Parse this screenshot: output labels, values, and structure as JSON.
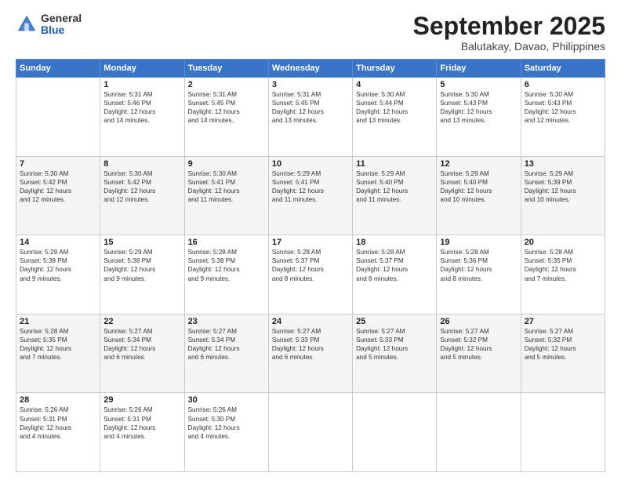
{
  "logo": {
    "general": "General",
    "blue": "Blue"
  },
  "title": "September 2025",
  "location": "Balutakay, Davao, Philippines",
  "days_of_week": [
    "Sunday",
    "Monday",
    "Tuesday",
    "Wednesday",
    "Thursday",
    "Friday",
    "Saturday"
  ],
  "weeks": [
    [
      {
        "day": "",
        "info": ""
      },
      {
        "day": "1",
        "info": "Sunrise: 5:31 AM\nSunset: 5:46 PM\nDaylight: 12 hours\nand 14 minutes."
      },
      {
        "day": "2",
        "info": "Sunrise: 5:31 AM\nSunset: 5:45 PM\nDaylight: 12 hours\nand 14 minutes."
      },
      {
        "day": "3",
        "info": "Sunrise: 5:31 AM\nSunset: 5:45 PM\nDaylight: 12 hours\nand 13 minutes."
      },
      {
        "day": "4",
        "info": "Sunrise: 5:30 AM\nSunset: 5:44 PM\nDaylight: 12 hours\nand 13 minutes."
      },
      {
        "day": "5",
        "info": "Sunrise: 5:30 AM\nSunset: 5:43 PM\nDaylight: 12 hours\nand 13 minutes."
      },
      {
        "day": "6",
        "info": "Sunrise: 5:30 AM\nSunset: 5:43 PM\nDaylight: 12 hours\nand 12 minutes."
      }
    ],
    [
      {
        "day": "7",
        "info": "Sunrise: 5:30 AM\nSunset: 5:42 PM\nDaylight: 12 hours\nand 12 minutes."
      },
      {
        "day": "8",
        "info": "Sunrise: 5:30 AM\nSunset: 5:42 PM\nDaylight: 12 hours\nand 12 minutes."
      },
      {
        "day": "9",
        "info": "Sunrise: 5:30 AM\nSunset: 5:41 PM\nDaylight: 12 hours\nand 11 minutes."
      },
      {
        "day": "10",
        "info": "Sunrise: 5:29 AM\nSunset: 5:41 PM\nDaylight: 12 hours\nand 11 minutes."
      },
      {
        "day": "11",
        "info": "Sunrise: 5:29 AM\nSunset: 5:40 PM\nDaylight: 12 hours\nand 11 minutes."
      },
      {
        "day": "12",
        "info": "Sunrise: 5:29 AM\nSunset: 5:40 PM\nDaylight: 12 hours\nand 10 minutes."
      },
      {
        "day": "13",
        "info": "Sunrise: 5:29 AM\nSunset: 5:39 PM\nDaylight: 12 hours\nand 10 minutes."
      }
    ],
    [
      {
        "day": "14",
        "info": "Sunrise: 5:29 AM\nSunset: 5:39 PM\nDaylight: 12 hours\nand 9 minutes."
      },
      {
        "day": "15",
        "info": "Sunrise: 5:29 AM\nSunset: 5:38 PM\nDaylight: 12 hours\nand 9 minutes."
      },
      {
        "day": "16",
        "info": "Sunrise: 5:28 AM\nSunset: 5:38 PM\nDaylight: 12 hours\nand 9 minutes."
      },
      {
        "day": "17",
        "info": "Sunrise: 5:28 AM\nSunset: 5:37 PM\nDaylight: 12 hours\nand 8 minutes."
      },
      {
        "day": "18",
        "info": "Sunrise: 5:28 AM\nSunset: 5:37 PM\nDaylight: 12 hours\nand 8 minutes."
      },
      {
        "day": "19",
        "info": "Sunrise: 5:28 AM\nSunset: 5:36 PM\nDaylight: 12 hours\nand 8 minutes."
      },
      {
        "day": "20",
        "info": "Sunrise: 5:28 AM\nSunset: 5:35 PM\nDaylight: 12 hours\nand 7 minutes."
      }
    ],
    [
      {
        "day": "21",
        "info": "Sunrise: 5:28 AM\nSunset: 5:35 PM\nDaylight: 12 hours\nand 7 minutes."
      },
      {
        "day": "22",
        "info": "Sunrise: 5:27 AM\nSunset: 5:34 PM\nDaylight: 12 hours\nand 6 minutes."
      },
      {
        "day": "23",
        "info": "Sunrise: 5:27 AM\nSunset: 5:34 PM\nDaylight: 12 hours\nand 6 minutes."
      },
      {
        "day": "24",
        "info": "Sunrise: 5:27 AM\nSunset: 5:33 PM\nDaylight: 12 hours\nand 6 minutes."
      },
      {
        "day": "25",
        "info": "Sunrise: 5:27 AM\nSunset: 5:33 PM\nDaylight: 12 hours\nand 5 minutes."
      },
      {
        "day": "26",
        "info": "Sunrise: 5:27 AM\nSunset: 5:32 PM\nDaylight: 12 hours\nand 5 minutes."
      },
      {
        "day": "27",
        "info": "Sunrise: 5:27 AM\nSunset: 5:32 PM\nDaylight: 12 hours\nand 5 minutes."
      }
    ],
    [
      {
        "day": "28",
        "info": "Sunrise: 5:26 AM\nSunset: 5:31 PM\nDaylight: 12 hours\nand 4 minutes."
      },
      {
        "day": "29",
        "info": "Sunrise: 5:26 AM\nSunset: 5:31 PM\nDaylight: 12 hours\nand 4 minutes."
      },
      {
        "day": "30",
        "info": "Sunrise: 5:26 AM\nSunset: 5:30 PM\nDaylight: 12 hours\nand 4 minutes."
      },
      {
        "day": "",
        "info": ""
      },
      {
        "day": "",
        "info": ""
      },
      {
        "day": "",
        "info": ""
      },
      {
        "day": "",
        "info": ""
      }
    ]
  ]
}
